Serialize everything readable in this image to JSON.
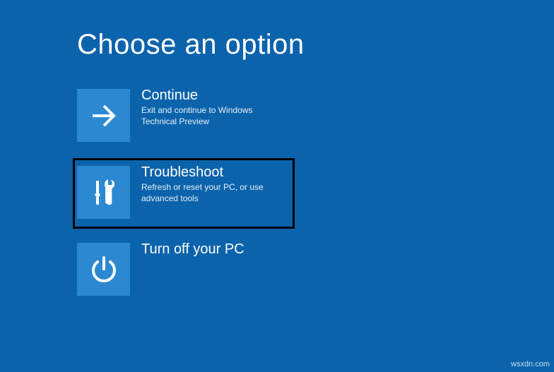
{
  "heading": "Choose an option",
  "options": {
    "continue": {
      "title": "Continue",
      "desc": "Exit and continue to Windows Technical Preview"
    },
    "troubleshoot": {
      "title": "Troubleshoot",
      "desc": "Refresh or reset your PC, or use advanced tools"
    },
    "turnoff": {
      "title": "Turn off your PC"
    }
  },
  "watermark": "wsxdn.com"
}
